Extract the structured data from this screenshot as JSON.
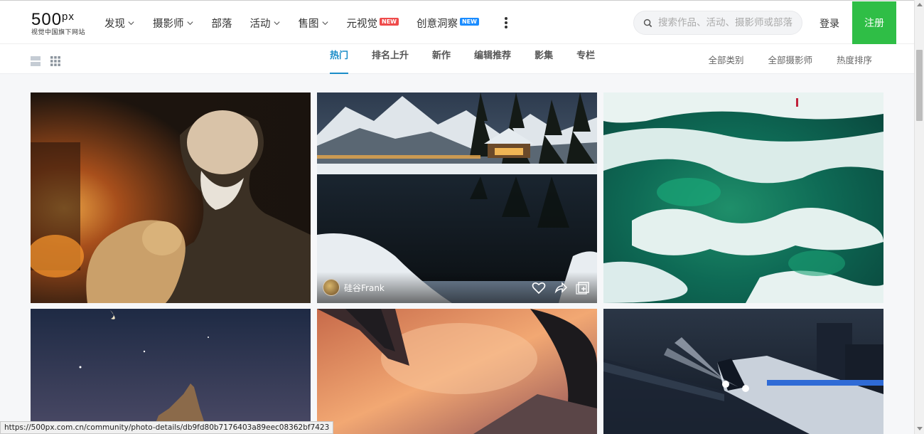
{
  "logo": {
    "text": "500",
    "suffix": "px",
    "subtitle": "视觉中国旗下网站"
  },
  "nav": {
    "items": [
      {
        "label": "发现",
        "dropdown": true
      },
      {
        "label": "摄影师",
        "dropdown": true
      },
      {
        "label": "部落",
        "dropdown": false
      },
      {
        "label": "活动",
        "dropdown": true
      },
      {
        "label": "售图",
        "dropdown": true
      },
      {
        "label": "元视觉",
        "badge": "NEW",
        "badge_color": "#ef4b4b"
      },
      {
        "label": "创意洞察",
        "badge": "NEW",
        "badge_color": "#1a8cff"
      }
    ],
    "more_icon": "more-vertical-icon"
  },
  "search": {
    "placeholder": "搜索作品、活动、摄影师或部落",
    "value": ""
  },
  "auth": {
    "login_label": "登录",
    "signup_label": "注册",
    "signup_color": "#2fbe46"
  },
  "subnav": {
    "view_modes": [
      "list-view-icon",
      "grid-view-icon"
    ],
    "tabs": [
      {
        "label": "热门",
        "active": true
      },
      {
        "label": "排名上升",
        "active": false
      },
      {
        "label": "新作",
        "active": false
      },
      {
        "label": "编辑推荐",
        "active": false
      },
      {
        "label": "影集",
        "active": false
      },
      {
        "label": "专栏",
        "active": false
      }
    ],
    "filters": [
      "全部类别",
      "全部摄影师",
      "热度排序"
    ],
    "accent": "#1a8cc8"
  },
  "photos": [
    {
      "subject": "old-man-with-dog-by-fireplace"
    },
    {
      "subject": "snowy-mountain-lodge-lake",
      "author": "硅谷Frank",
      "actions": [
        "heart-icon",
        "share-icon",
        "add-to-gallery-icon"
      ]
    },
    {
      "subject": "frozen-green-ice-lake"
    },
    {
      "subject": "night-sky-moon-castle"
    },
    {
      "subject": "sunset-sky-skyscrapers"
    },
    {
      "subject": "night-train-lights"
    }
  ],
  "status_url": "https://500px.com.cn/community/photo-details/db9fd80b7176403a89eec08362bf7423"
}
